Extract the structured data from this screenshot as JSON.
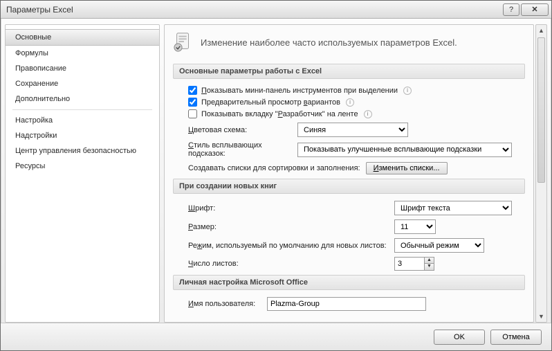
{
  "window": {
    "title": "Параметры Excel"
  },
  "sidebar": {
    "items": [
      {
        "label": "Основные",
        "selected": true
      },
      {
        "label": "Формулы"
      },
      {
        "label": "Правописание"
      },
      {
        "label": "Сохранение"
      },
      {
        "label": "Дополнительно"
      },
      {
        "sep": true
      },
      {
        "label": "Настройка"
      },
      {
        "label": "Надстройки"
      },
      {
        "label": "Центр управления безопасностью"
      },
      {
        "label": "Ресурсы"
      }
    ]
  },
  "banner": {
    "text": "Изменение наиболее часто используемых параметров Excel."
  },
  "sections": {
    "main": {
      "title": "Основные параметры работы с Excel",
      "chk_mini_panel": {
        "checked": true,
        "label": "Показывать мини-панель инструментов при выделении"
      },
      "chk_preview": {
        "checked": true,
        "label": "Предварительный просмотр вариантов"
      },
      "chk_devtab": {
        "checked": false,
        "label": "Показывать вкладку \"Разработчик\" на ленте"
      },
      "color_scheme_label": "Цветовая схема:",
      "color_scheme_value": "Синяя",
      "tooltip_style_label": "Стиль всплывающих подсказок:",
      "tooltip_style_value": "Показывать улучшенные всплывающие подсказки",
      "lists_label": "Создавать списки для сортировки и заполнения:",
      "lists_button": "Изменить списки..."
    },
    "newbooks": {
      "title": "При создании новых книг",
      "font_label": "Шрифт:",
      "font_value": "Шрифт текста",
      "size_label": "Размер:",
      "size_value": "11",
      "mode_label": "Режим, используемый по умолчанию для новых листов:",
      "mode_value": "Обычный режим",
      "sheets_label": "Число листов:",
      "sheets_value": "3"
    },
    "personal": {
      "title": "Личная настройка Microsoft Office",
      "username_label": "Имя пользователя:",
      "username_value": "Plazma-Group"
    }
  },
  "footer": {
    "ok": "OK",
    "cancel": "Отмена"
  }
}
